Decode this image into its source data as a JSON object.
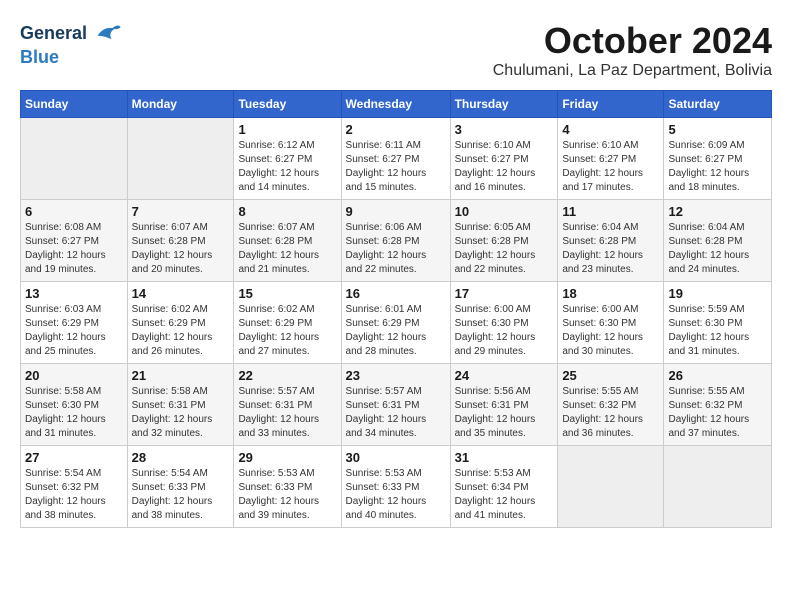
{
  "header": {
    "logo": {
      "general": "General",
      "blue": "Blue"
    },
    "title": "October 2024",
    "location": "Chulumani, La Paz Department, Bolivia"
  },
  "calendar": {
    "days_of_week": [
      "Sunday",
      "Monday",
      "Tuesday",
      "Wednesday",
      "Thursday",
      "Friday",
      "Saturday"
    ],
    "weeks": [
      [
        {
          "day": "",
          "sunrise": "",
          "sunset": "",
          "daylight": ""
        },
        {
          "day": "",
          "sunrise": "",
          "sunset": "",
          "daylight": ""
        },
        {
          "day": "1",
          "sunrise": "Sunrise: 6:12 AM",
          "sunset": "Sunset: 6:27 PM",
          "daylight": "Daylight: 12 hours and 14 minutes."
        },
        {
          "day": "2",
          "sunrise": "Sunrise: 6:11 AM",
          "sunset": "Sunset: 6:27 PM",
          "daylight": "Daylight: 12 hours and 15 minutes."
        },
        {
          "day": "3",
          "sunrise": "Sunrise: 6:10 AM",
          "sunset": "Sunset: 6:27 PM",
          "daylight": "Daylight: 12 hours and 16 minutes."
        },
        {
          "day": "4",
          "sunrise": "Sunrise: 6:10 AM",
          "sunset": "Sunset: 6:27 PM",
          "daylight": "Daylight: 12 hours and 17 minutes."
        },
        {
          "day": "5",
          "sunrise": "Sunrise: 6:09 AM",
          "sunset": "Sunset: 6:27 PM",
          "daylight": "Daylight: 12 hours and 18 minutes."
        }
      ],
      [
        {
          "day": "6",
          "sunrise": "Sunrise: 6:08 AM",
          "sunset": "Sunset: 6:27 PM",
          "daylight": "Daylight: 12 hours and 19 minutes."
        },
        {
          "day": "7",
          "sunrise": "Sunrise: 6:07 AM",
          "sunset": "Sunset: 6:28 PM",
          "daylight": "Daylight: 12 hours and 20 minutes."
        },
        {
          "day": "8",
          "sunrise": "Sunrise: 6:07 AM",
          "sunset": "Sunset: 6:28 PM",
          "daylight": "Daylight: 12 hours and 21 minutes."
        },
        {
          "day": "9",
          "sunrise": "Sunrise: 6:06 AM",
          "sunset": "Sunset: 6:28 PM",
          "daylight": "Daylight: 12 hours and 22 minutes."
        },
        {
          "day": "10",
          "sunrise": "Sunrise: 6:05 AM",
          "sunset": "Sunset: 6:28 PM",
          "daylight": "Daylight: 12 hours and 22 minutes."
        },
        {
          "day": "11",
          "sunrise": "Sunrise: 6:04 AM",
          "sunset": "Sunset: 6:28 PM",
          "daylight": "Daylight: 12 hours and 23 minutes."
        },
        {
          "day": "12",
          "sunrise": "Sunrise: 6:04 AM",
          "sunset": "Sunset: 6:28 PM",
          "daylight": "Daylight: 12 hours and 24 minutes."
        }
      ],
      [
        {
          "day": "13",
          "sunrise": "Sunrise: 6:03 AM",
          "sunset": "Sunset: 6:29 PM",
          "daylight": "Daylight: 12 hours and 25 minutes."
        },
        {
          "day": "14",
          "sunrise": "Sunrise: 6:02 AM",
          "sunset": "Sunset: 6:29 PM",
          "daylight": "Daylight: 12 hours and 26 minutes."
        },
        {
          "day": "15",
          "sunrise": "Sunrise: 6:02 AM",
          "sunset": "Sunset: 6:29 PM",
          "daylight": "Daylight: 12 hours and 27 minutes."
        },
        {
          "day": "16",
          "sunrise": "Sunrise: 6:01 AM",
          "sunset": "Sunset: 6:29 PM",
          "daylight": "Daylight: 12 hours and 28 minutes."
        },
        {
          "day": "17",
          "sunrise": "Sunrise: 6:00 AM",
          "sunset": "Sunset: 6:30 PM",
          "daylight": "Daylight: 12 hours and 29 minutes."
        },
        {
          "day": "18",
          "sunrise": "Sunrise: 6:00 AM",
          "sunset": "Sunset: 6:30 PM",
          "daylight": "Daylight: 12 hours and 30 minutes."
        },
        {
          "day": "19",
          "sunrise": "Sunrise: 5:59 AM",
          "sunset": "Sunset: 6:30 PM",
          "daylight": "Daylight: 12 hours and 31 minutes."
        }
      ],
      [
        {
          "day": "20",
          "sunrise": "Sunrise: 5:58 AM",
          "sunset": "Sunset: 6:30 PM",
          "daylight": "Daylight: 12 hours and 31 minutes."
        },
        {
          "day": "21",
          "sunrise": "Sunrise: 5:58 AM",
          "sunset": "Sunset: 6:31 PM",
          "daylight": "Daylight: 12 hours and 32 minutes."
        },
        {
          "day": "22",
          "sunrise": "Sunrise: 5:57 AM",
          "sunset": "Sunset: 6:31 PM",
          "daylight": "Daylight: 12 hours and 33 minutes."
        },
        {
          "day": "23",
          "sunrise": "Sunrise: 5:57 AM",
          "sunset": "Sunset: 6:31 PM",
          "daylight": "Daylight: 12 hours and 34 minutes."
        },
        {
          "day": "24",
          "sunrise": "Sunrise: 5:56 AM",
          "sunset": "Sunset: 6:31 PM",
          "daylight": "Daylight: 12 hours and 35 minutes."
        },
        {
          "day": "25",
          "sunrise": "Sunrise: 5:55 AM",
          "sunset": "Sunset: 6:32 PM",
          "daylight": "Daylight: 12 hours and 36 minutes."
        },
        {
          "day": "26",
          "sunrise": "Sunrise: 5:55 AM",
          "sunset": "Sunset: 6:32 PM",
          "daylight": "Daylight: 12 hours and 37 minutes."
        }
      ],
      [
        {
          "day": "27",
          "sunrise": "Sunrise: 5:54 AM",
          "sunset": "Sunset: 6:32 PM",
          "daylight": "Daylight: 12 hours and 38 minutes."
        },
        {
          "day": "28",
          "sunrise": "Sunrise: 5:54 AM",
          "sunset": "Sunset: 6:33 PM",
          "daylight": "Daylight: 12 hours and 38 minutes."
        },
        {
          "day": "29",
          "sunrise": "Sunrise: 5:53 AM",
          "sunset": "Sunset: 6:33 PM",
          "daylight": "Daylight: 12 hours and 39 minutes."
        },
        {
          "day": "30",
          "sunrise": "Sunrise: 5:53 AM",
          "sunset": "Sunset: 6:33 PM",
          "daylight": "Daylight: 12 hours and 40 minutes."
        },
        {
          "day": "31",
          "sunrise": "Sunrise: 5:53 AM",
          "sunset": "Sunset: 6:34 PM",
          "daylight": "Daylight: 12 hours and 41 minutes."
        },
        {
          "day": "",
          "sunrise": "",
          "sunset": "",
          "daylight": ""
        },
        {
          "day": "",
          "sunrise": "",
          "sunset": "",
          "daylight": ""
        }
      ]
    ]
  }
}
